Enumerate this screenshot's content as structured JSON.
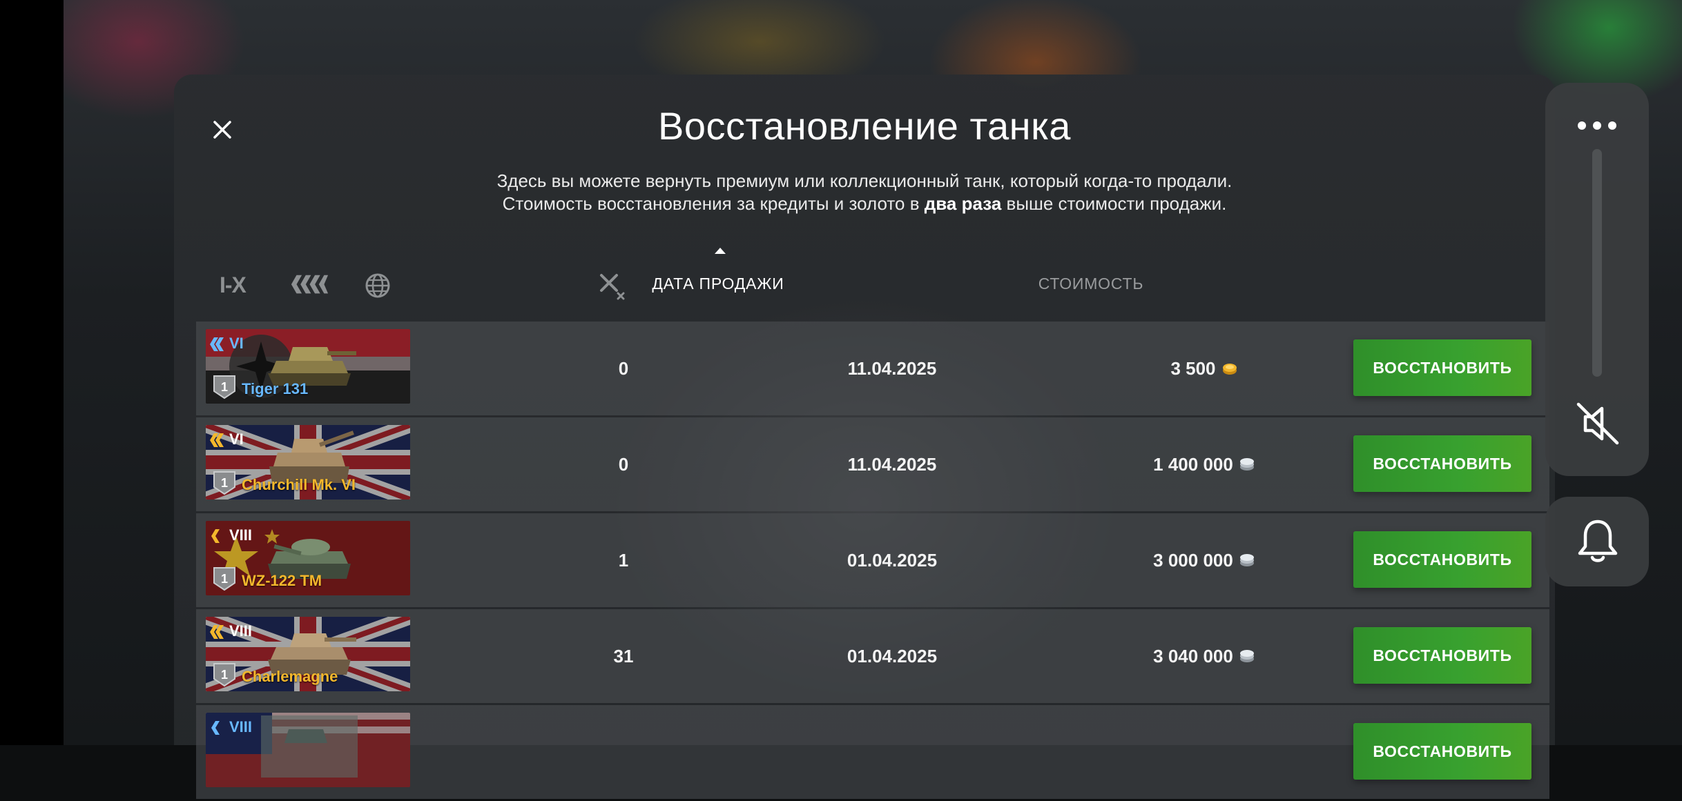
{
  "dialog": {
    "title": "Восстановление танка",
    "desc_line1": "Здесь вы можете вернуть премиум или коллекционный танк, который когда-то продали.",
    "desc_line2_pre": "Стоимость восстановления за кредиты и золото в ",
    "desc_line2_bold": "два раза",
    "desc_line2_post": " выше стоимости продажи."
  },
  "filters": {
    "tier_label": "I-X",
    "type_icon": "tank-type-icon",
    "nation_icon": "globe-icon",
    "battles_icon": "crossed-swords-icon"
  },
  "columns": {
    "date": "ДАТА ПРОДАЖИ",
    "date_sort": "ascending-arrow",
    "cost": "СТОИМОСТЬ"
  },
  "restore_label": "ВОССТАНОВИТЬ",
  "tanks": [
    {
      "tier": "VI",
      "name": "Tiger 131",
      "mastery": "1",
      "flag": "germany",
      "battles": "0",
      "date": "11.04.2025",
      "cost": "3 500",
      "currency": "gold",
      "name_color": "#68b8ff"
    },
    {
      "tier": "VI",
      "name": "Churchill Mk. VI",
      "mastery": "1",
      "flag": "uk",
      "battles": "0",
      "date": "11.04.2025",
      "cost": "1 400 000",
      "currency": "credits",
      "name_color": "#f3b72c"
    },
    {
      "tier": "VIII",
      "name": "WZ-122 TM",
      "mastery": "1",
      "flag": "china",
      "battles": "1",
      "date": "01.04.2025",
      "cost": "3 000 000",
      "currency": "credits",
      "name_color": "#f3b72c"
    },
    {
      "tier": "VIII",
      "name": "Charlemagne",
      "mastery": "1",
      "flag": "uk",
      "battles": "31",
      "date": "01.04.2025",
      "cost": "3 040 000",
      "currency": "credits",
      "name_color": "#f3b72c"
    },
    {
      "tier": "VIII",
      "name": "",
      "mastery": "",
      "flag": "usa",
      "battles": "",
      "date": "",
      "cost": "",
      "currency": "gold",
      "name_color": "#68b8ff"
    }
  ],
  "colors": {
    "gold": "#f3b72c",
    "premium_blue": "#68b8ff",
    "button_green": "#38a12f"
  },
  "side": {
    "more_icon": "more-dots-icon",
    "volume_slider": "volume-slider",
    "mute_icon": "speaker-muted-icon",
    "bell_icon": "bell-icon"
  }
}
